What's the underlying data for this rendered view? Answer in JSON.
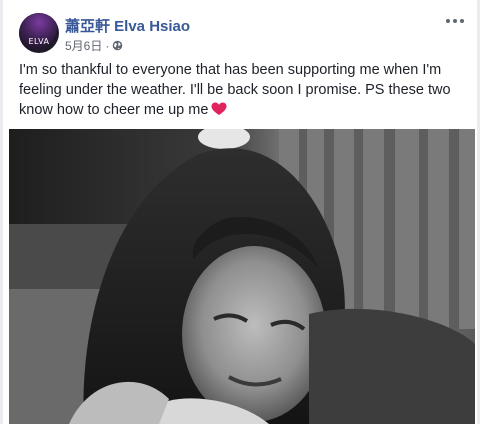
{
  "post": {
    "avatar_text": "ELVA",
    "author": "蕭亞軒 Elva Hsiao",
    "date": "5月6日",
    "separator": "·",
    "privacy_icon": "globe-icon",
    "more_icon": "more-options-icon",
    "text": "I'm so thankful to everyone that has been supporting me when I'm feeling under the weather. I'll be back soon I promise. PS these two know how to cheer me up me",
    "emoji_icon": "heart-icon",
    "heart_color": "#e0245e",
    "link_color": "#385898",
    "photo_description_icon": "black-and-white-portrait-photo"
  }
}
